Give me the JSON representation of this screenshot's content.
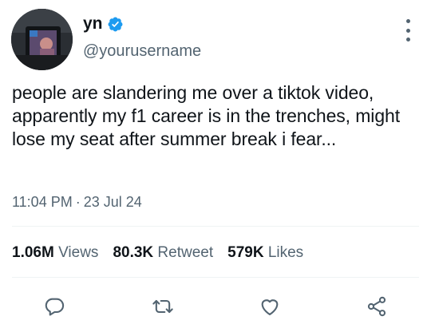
{
  "tweet": {
    "display_name": "yn",
    "handle": "@yourusername",
    "text": "people are slandering me over a tiktok video, apparently my f1 career is in the trenches, might lose my seat after summer break i fear...",
    "time": "11:04 PM",
    "separator": "·",
    "date": "23 Jul 24"
  },
  "stats": {
    "views_count": "1.06M",
    "views_label": "Views",
    "retweets_count": "80.3K",
    "retweets_label": "Retweet",
    "likes_count": "579K",
    "likes_label": "Likes"
  },
  "icons": {
    "verified": "verified-badge-icon",
    "more": "more-vertical-icon",
    "reply": "reply-icon",
    "retweet": "retweet-icon",
    "like": "heart-icon",
    "share": "share-icon"
  },
  "colors": {
    "verified_blue": "#1d9bf0",
    "secondary_text": "#536471",
    "primary_text": "#0f1419",
    "divider": "#eff3f4"
  }
}
